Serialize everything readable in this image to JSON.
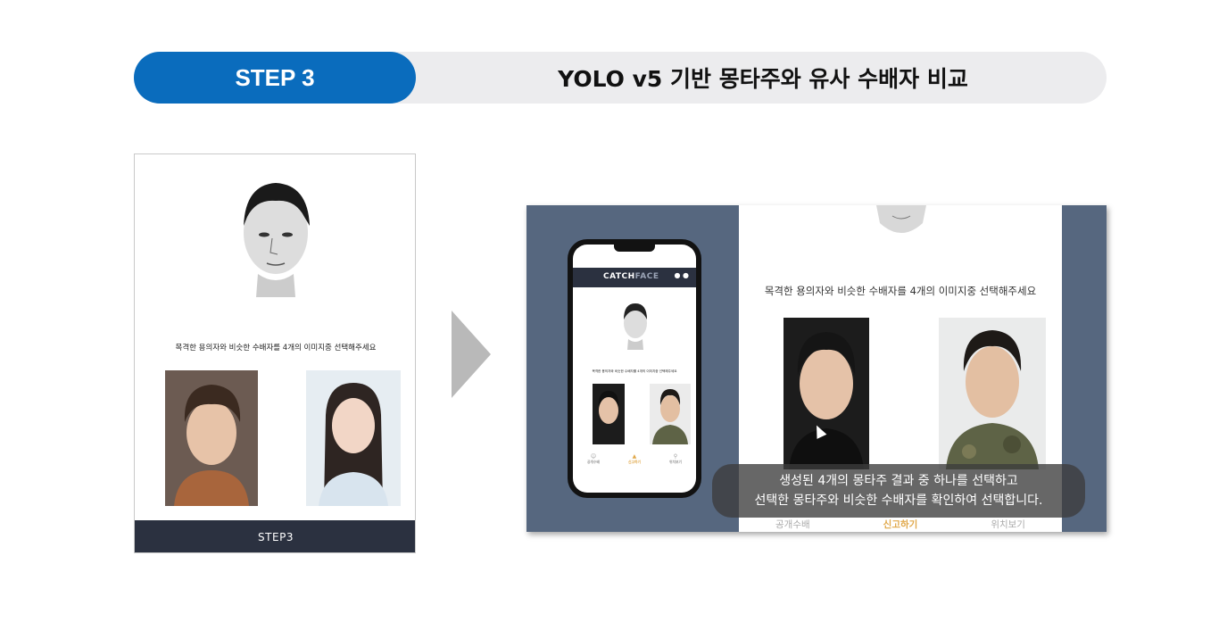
{
  "header": {
    "step_label": "STEP 3",
    "title": "YOLO v5 기반 몽타주와 유사 수배자 비교"
  },
  "left_panel": {
    "instruction": "목격한 용의자와 비슷한 수배자를 4개의 이미지중 선택해주세요",
    "button_label": "STEP3"
  },
  "video": {
    "instruction": "목격한 용의자와 비슷한 수배자를 4개의 이미지중 선택해주세요",
    "phone": {
      "brand_main": "CATCH",
      "brand_sub": "FACE",
      "instruction": "목격한 용의자와 비슷한 수배자를 4개의 이미지중 선택해주세요",
      "nav": [
        "공개수배",
        "신고하기",
        "위치보기"
      ]
    },
    "bottom_nav": [
      "공개수배",
      "신고하기",
      "위치보기"
    ],
    "active_nav_index": 1,
    "caption_line1": "생성된 4개의 몽타주 결과 중 하나를 선택하고",
    "caption_line2": "선택한 몽타주와 비슷한 수배자를 확인하여 선택합니다."
  },
  "colors": {
    "accent_blue": "#0a6cbd",
    "dark_navy": "#2b3140",
    "video_bg": "#56677f",
    "active_nav": "#e0a84a"
  }
}
